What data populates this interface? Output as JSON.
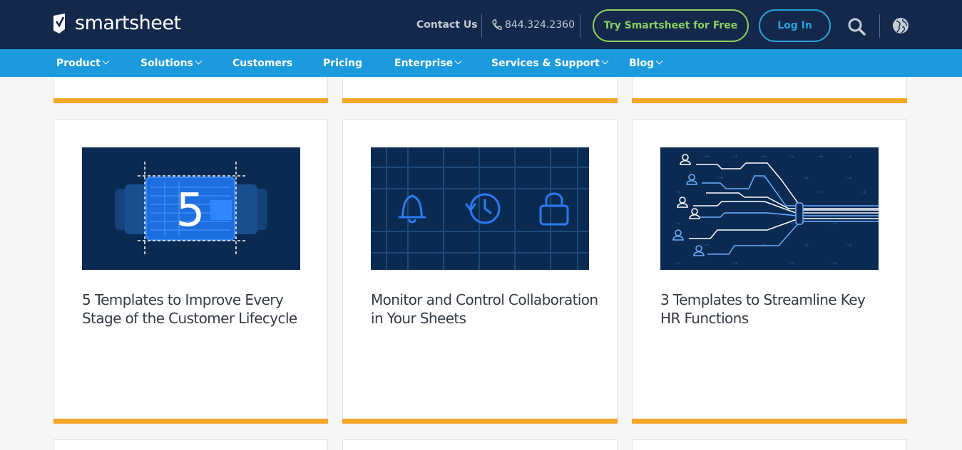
{
  "header": {
    "logo_text": "smartsheet",
    "contact_label": "Contact Us",
    "phone": "844.324.2360",
    "try_label": "Try Smartsheet for Free",
    "login_label": "Log In",
    "icons": [
      "phone-icon",
      "search-icon",
      "globe-icon"
    ]
  },
  "nav": {
    "items": [
      {
        "label": "Product",
        "dropdown": true
      },
      {
        "label": "Solutions",
        "dropdown": true
      },
      {
        "label": "Customers",
        "dropdown": false
      },
      {
        "label": "Pricing",
        "dropdown": false
      },
      {
        "label": "Enterprise",
        "dropdown": true
      },
      {
        "label": "Services & Support",
        "dropdown": true
      },
      {
        "label": "Blog",
        "dropdown": true
      }
    ]
  },
  "cards": [
    {
      "title": "5 Templates to Improve Every Stage of the Customer Lifecycle",
      "image_text": "5",
      "image": "templates-number-five"
    },
    {
      "title": "Monitor and Control Collaboration in Your Sheets",
      "image": "bell-history-lock-icons"
    },
    {
      "title": "3 Templates to Streamline Key HR Functions",
      "image": "people-network-lines"
    }
  ],
  "colors": {
    "topbar": "#13284a",
    "navbar": "#1c9ade",
    "accent_green": "#8bd15f",
    "accent_blue": "#2aa3dc",
    "card_bar": "#f5a623",
    "image_bg": "#0b2a52"
  }
}
